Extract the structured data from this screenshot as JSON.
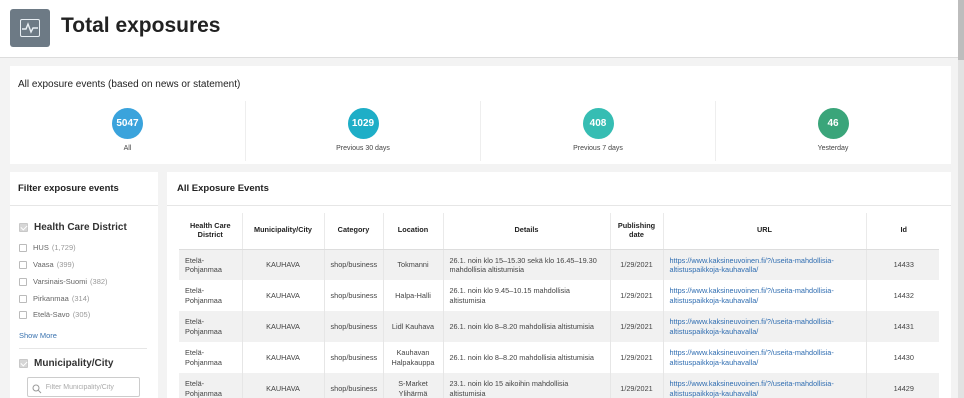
{
  "header": {
    "title": "Total exposures",
    "icon": "activity-chart-icon"
  },
  "summary": {
    "title": "All exposure events (based on news or statement)",
    "stats": [
      {
        "value": "5047",
        "label": "All",
        "color": "#3aa3dc"
      },
      {
        "value": "1029",
        "label": "Previous 30 days",
        "color": "#1eaec7"
      },
      {
        "value": "408",
        "label": "Previous 7 days",
        "color": "#36bdb3"
      },
      {
        "value": "46",
        "label": "Yesterday",
        "color": "#3aa57a"
      }
    ]
  },
  "filter": {
    "title": "Filter exposure events",
    "hcd": {
      "label": "Health Care District",
      "options": [
        {
          "name": "HUS",
          "count": "(1,729)"
        },
        {
          "name": "Vaasa",
          "count": "(399)"
        },
        {
          "name": "Varsinais-Suomi",
          "count": "(382)"
        },
        {
          "name": "Pirkanmaa",
          "count": "(314)"
        },
        {
          "name": "Etelä-Savo",
          "count": "(305)"
        }
      ],
      "show_more": "Show More"
    },
    "municipality": {
      "label": "Municipality/City",
      "search_placeholder": "Filter Municipality/City"
    }
  },
  "events": {
    "title": "All Exposure Events",
    "columns": [
      "Health Care District",
      "Municipality/City",
      "Category",
      "Location",
      "Details",
      "Publishing date",
      "URL",
      "Id"
    ],
    "rows": [
      {
        "district": "Etelä-Pohjanmaa",
        "city": "KAUHAVA",
        "category": "shop/business",
        "location": "Tokmanni",
        "details": "26.1. noin klo 15–15.30 sekä klo 16.45–19.30 mahdollisia altistumisia",
        "date": "1/29/2021",
        "url": "https://www.kaksineuvoinen.fi/?/useita-mahdollisia-altistuspaikkoja-kauhavalla/",
        "id": "14433"
      },
      {
        "district": "Etelä-Pohjanmaa",
        "city": "KAUHAVA",
        "category": "shop/business",
        "location": "Halpa-Halli",
        "details": "26.1. noin klo 9.45–10.15 mahdollisia altistumisia",
        "date": "1/29/2021",
        "url": "https://www.kaksineuvoinen.fi/?/useita-mahdollisia-altistuspaikkoja-kauhavalla/",
        "id": "14432"
      },
      {
        "district": "Etelä-Pohjanmaa",
        "city": "KAUHAVA",
        "category": "shop/business",
        "location": "Lidl Kauhava",
        "details": "26.1. noin klo 8–8.20 mahdollisia altistumisia",
        "date": "1/29/2021",
        "url": "https://www.kaksineuvoinen.fi/?/useita-mahdollisia-altistuspaikkoja-kauhavalla/",
        "id": "14431"
      },
      {
        "district": "Etelä-Pohjanmaa",
        "city": "KAUHAVA",
        "category": "shop/business",
        "location": "Kauhavan Halpakauppa",
        "details": "26.1. noin klo 8–8.20 mahdollisia altistumisia",
        "date": "1/29/2021",
        "url": "https://www.kaksineuvoinen.fi/?/useita-mahdollisia-altistuspaikkoja-kauhavalla/",
        "id": "14430"
      },
      {
        "district": "Etelä-Pohjanmaa",
        "city": "KAUHAVA",
        "category": "shop/business",
        "location": "S-Market Ylihärmä",
        "details": "23.1. noin klo 15 aikoihin mahdollisia altistumisia",
        "date": "1/29/2021",
        "url": "https://www.kaksineuvoinen.fi/?/useita-mahdollisia-altistuspaikkoja-kauhavalla/",
        "id": "14429"
      }
    ]
  }
}
